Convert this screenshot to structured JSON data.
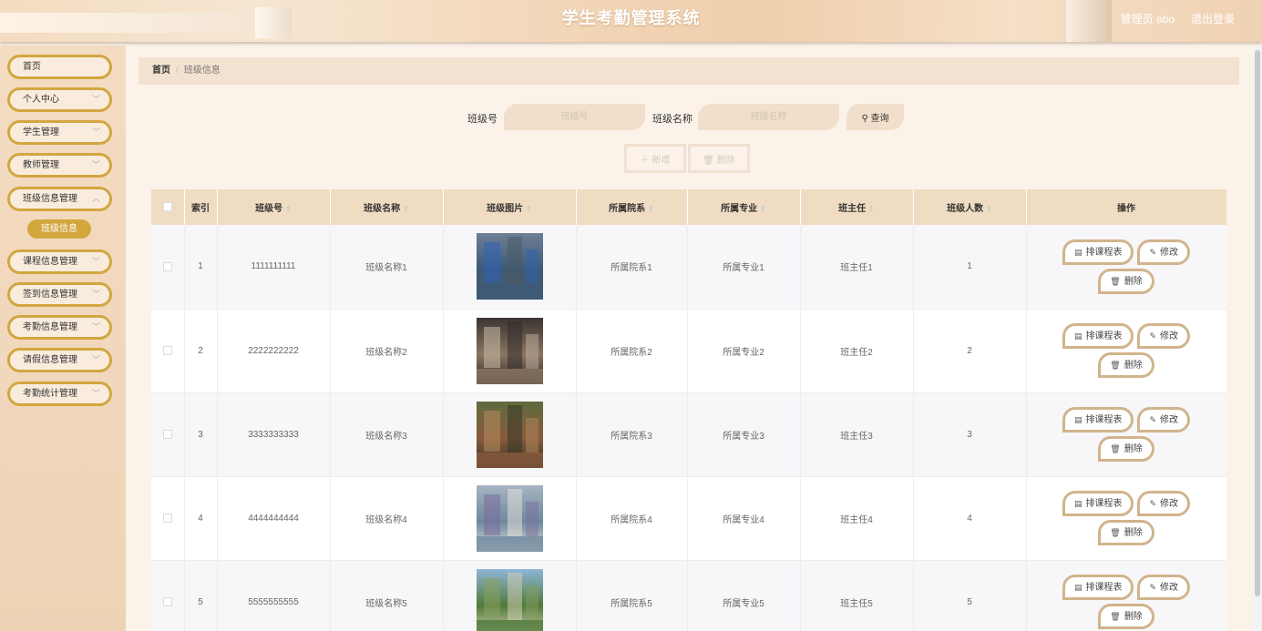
{
  "header": {
    "title": "学生考勤管理系统",
    "user": "管理员 abo",
    "logout": "退出登录"
  },
  "sidebar": {
    "items": [
      {
        "label": "首页"
      },
      {
        "label": "个人中心"
      },
      {
        "label": "学生管理"
      },
      {
        "label": "教师管理"
      },
      {
        "label": "班级信息管理"
      },
      {
        "label": "课程信息管理"
      },
      {
        "label": "签到信息管理"
      },
      {
        "label": "考勤信息管理"
      },
      {
        "label": "请假信息管理"
      },
      {
        "label": "考勤统计管理"
      }
    ],
    "active_sub": "班级信息"
  },
  "breadcrumb": {
    "home": "首页",
    "current": "班级信息"
  },
  "search": {
    "label1": "班级号",
    "placeholder1": "班级号",
    "label2": "班级名称",
    "placeholder2": "班级名称",
    "query": "查询"
  },
  "actions": {
    "add": "新增",
    "delete": "删除"
  },
  "table": {
    "headers": [
      "索引",
      "班级号",
      "班级名称",
      "班级图片",
      "所属院系",
      "所属专业",
      "班主任",
      "班级人数",
      "操作"
    ],
    "rows": [
      {
        "index": "1",
        "no": "1111111111",
        "name": "班级名称1",
        "dept": "所属院系1",
        "major": "所属专业1",
        "teacher": "班主任1",
        "count": "1"
      },
      {
        "index": "2",
        "no": "2222222222",
        "name": "班级名称2",
        "dept": "所属院系2",
        "major": "所属专业2",
        "teacher": "班主任2",
        "count": "2"
      },
      {
        "index": "3",
        "no": "3333333333",
        "name": "班级名称3",
        "dept": "所属院系3",
        "major": "所属专业3",
        "teacher": "班主任3",
        "count": "3"
      },
      {
        "index": "4",
        "no": "4444444444",
        "name": "班级名称4",
        "dept": "所属院系4",
        "major": "所属专业4",
        "teacher": "班主任4",
        "count": "4"
      },
      {
        "index": "5",
        "no": "5555555555",
        "name": "班级名称5",
        "dept": "所属院系5",
        "major": "所属专业5",
        "teacher": "班主任5",
        "count": "5"
      }
    ],
    "op_labels": {
      "schedule": "排课程表",
      "edit": "修改",
      "delete": "删除"
    }
  },
  "icons": {
    "search": "search-icon",
    "plus": "plus-icon",
    "trash": "trash-icon",
    "chevron": "chevron-down-icon",
    "doc": "document-icon",
    "pencil": "pencil-icon",
    "sort": "sort-icon"
  }
}
